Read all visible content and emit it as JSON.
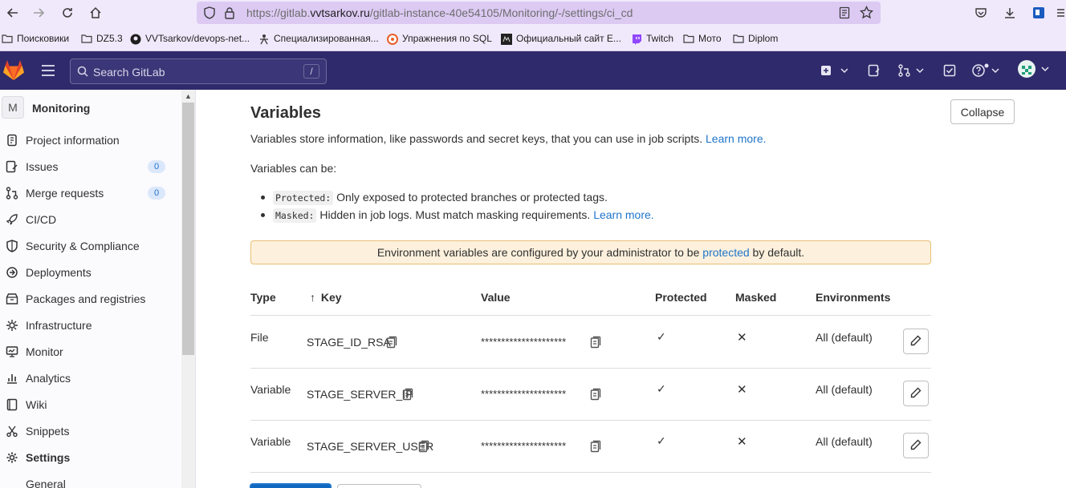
{
  "browser": {
    "url_prefix": "https://gitlab.",
    "url_domain": "vvtsarkov.ru",
    "url_path": "/gitlab-instance-40e54105/Monitoring/-/settings/ci_cd",
    "bookmarks": [
      "Поисковики",
      "DZ5.3",
      "VVTsarkov/devops-net...",
      "Специализированная...",
      "Упражнения по SQL",
      "Официальный сайт Е...",
      "Twitch",
      "Мото",
      "Diplom"
    ]
  },
  "header": {
    "search_placeholder": "Search GitLab",
    "search_shortcut": "/"
  },
  "sidebar": {
    "project_initial": "M",
    "project_name": "Monitoring",
    "items": [
      {
        "label": "Project information"
      },
      {
        "label": "Issues",
        "badge": "0"
      },
      {
        "label": "Merge requests",
        "badge": "0"
      },
      {
        "label": "CI/CD"
      },
      {
        "label": "Security & Compliance"
      },
      {
        "label": "Deployments"
      },
      {
        "label": "Packages and registries"
      },
      {
        "label": "Infrastructure"
      },
      {
        "label": "Monitor"
      },
      {
        "label": "Analytics"
      },
      {
        "label": "Wiki"
      },
      {
        "label": "Snippets"
      },
      {
        "label": "Settings"
      }
    ],
    "sub_item": "General"
  },
  "main": {
    "title": "Variables",
    "collapse_label": "Collapse",
    "intro_text": "Variables store information, like passwords and secret keys, that you can use in job scripts.",
    "intro_link": "Learn more.",
    "can_be_text": "Variables can be:",
    "bullets": [
      {
        "code": "Protected:",
        "text": "Only exposed to protected branches or protected tags.",
        "link": ""
      },
      {
        "code": "Masked:",
        "text": "Hidden in job logs. Must match masking requirements.",
        "link": "Learn more."
      }
    ],
    "alert": {
      "before": "Environment variables are configured by your administrator to be",
      "link": "protected",
      "after": "by default."
    },
    "table": {
      "headers": {
        "type": "Type",
        "key_arrow": "↑",
        "key": "Key",
        "value": "Value",
        "protected": "Protected",
        "masked": "Masked",
        "environments": "Environments"
      },
      "rows": [
        {
          "type": "File",
          "key": "STAGE_ID_RSA",
          "value": "*********************",
          "protected": "✓",
          "masked": "✕",
          "env": "All (default)"
        },
        {
          "type": "Variable",
          "key": "STAGE_SERVER_IP",
          "value": "*********************",
          "protected": "✓",
          "masked": "✕",
          "env": "All (default)"
        },
        {
          "type": "Variable",
          "key": "STAGE_SERVER_USER",
          "value": "*********************",
          "protected": "✓",
          "masked": "✕",
          "env": "All (default)"
        }
      ]
    }
  }
}
